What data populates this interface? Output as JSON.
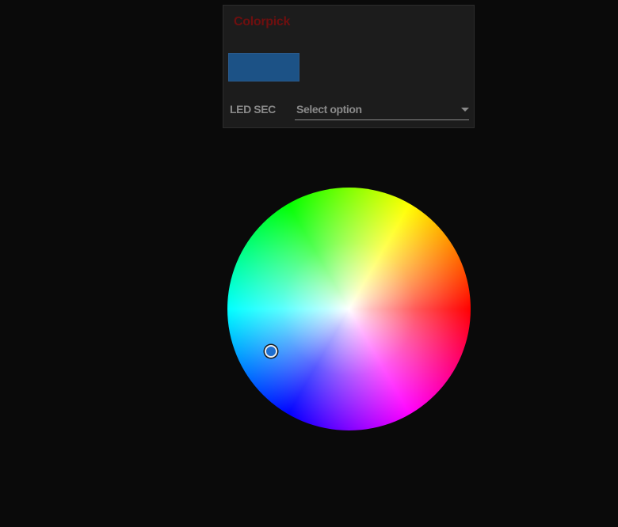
{
  "panel": {
    "title": "Colorpick",
    "swatch_color": "#1c5286",
    "select_label": "LED SEC",
    "select_placeholder": "Select option",
    "caret_icon": "triangle-down-icon"
  },
  "color_wheel": {
    "selected_color": "#1d6fd1",
    "colors": {
      "background": "#0a0a0a",
      "panel": "#1c1c1c",
      "title": "#6e0f0f",
      "label": "#8a8a8a"
    }
  }
}
